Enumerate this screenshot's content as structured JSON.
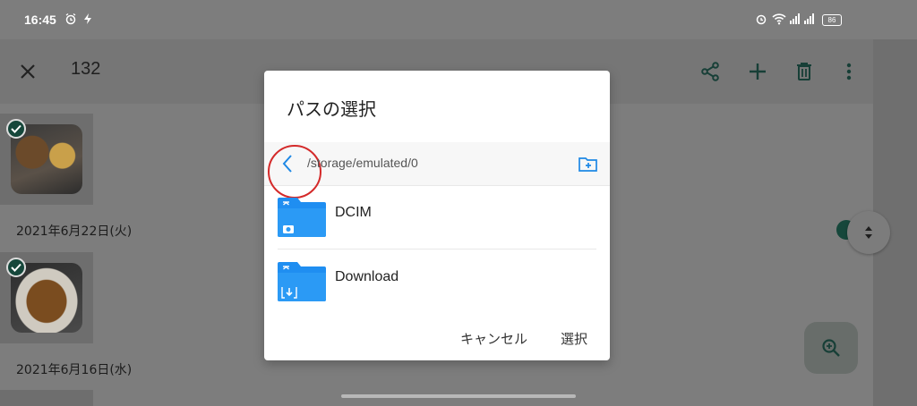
{
  "status_bar": {
    "time": "16:45",
    "battery": "86",
    "icons": [
      "alarm-icon",
      "flash-icon",
      "wifi-icon",
      "signal-icon",
      "battery-icon"
    ]
  },
  "toolbar": {
    "selected_count": "132",
    "icons": [
      "close-icon",
      "share-icon",
      "add-icon",
      "delete-icon",
      "more-icon"
    ]
  },
  "gallery": {
    "dates": [
      "2021年6月22日(火)",
      "2021年6月16日(水)"
    ]
  },
  "dialog": {
    "title": "パスの選択",
    "path": "/storage/emulated/0",
    "folders": [
      {
        "name": "DCIM",
        "icon": "camera-folder-icon"
      },
      {
        "name": "Download",
        "icon": "download-folder-icon"
      }
    ],
    "cancel_label": "キャンセル",
    "select_label": "選択"
  },
  "colors": {
    "accent": "#1e88e5",
    "folder": "#1f8ef1",
    "annotation": "#d42a2a"
  }
}
